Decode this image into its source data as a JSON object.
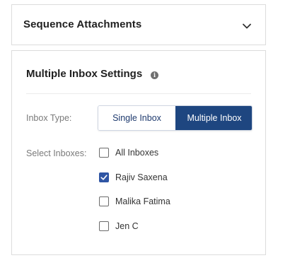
{
  "accordion": {
    "title": "Sequence Attachments",
    "icon": "chevron-down-icon"
  },
  "settings": {
    "title": "Multiple Inbox Settings",
    "info_icon": "info-icon",
    "inbox_type_label": "Inbox Type:",
    "inbox_type_options": [
      {
        "label": "Single Inbox",
        "selected": false
      },
      {
        "label": "Multiple Inbox",
        "selected": true
      }
    ],
    "select_inboxes_label": "Select Inboxes:",
    "inboxes": [
      {
        "label": "All Inboxes",
        "checked": false
      },
      {
        "label": "Rajiv Saxena",
        "checked": true
      },
      {
        "label": "Malika Fatima",
        "checked": false
      },
      {
        "label": "Jen C",
        "checked": false
      }
    ]
  },
  "colors": {
    "primary": "#1e4680",
    "checkbox_checked": "#2f55a4",
    "border": "#dcdcdc",
    "label_gray": "#7a7a7a"
  }
}
